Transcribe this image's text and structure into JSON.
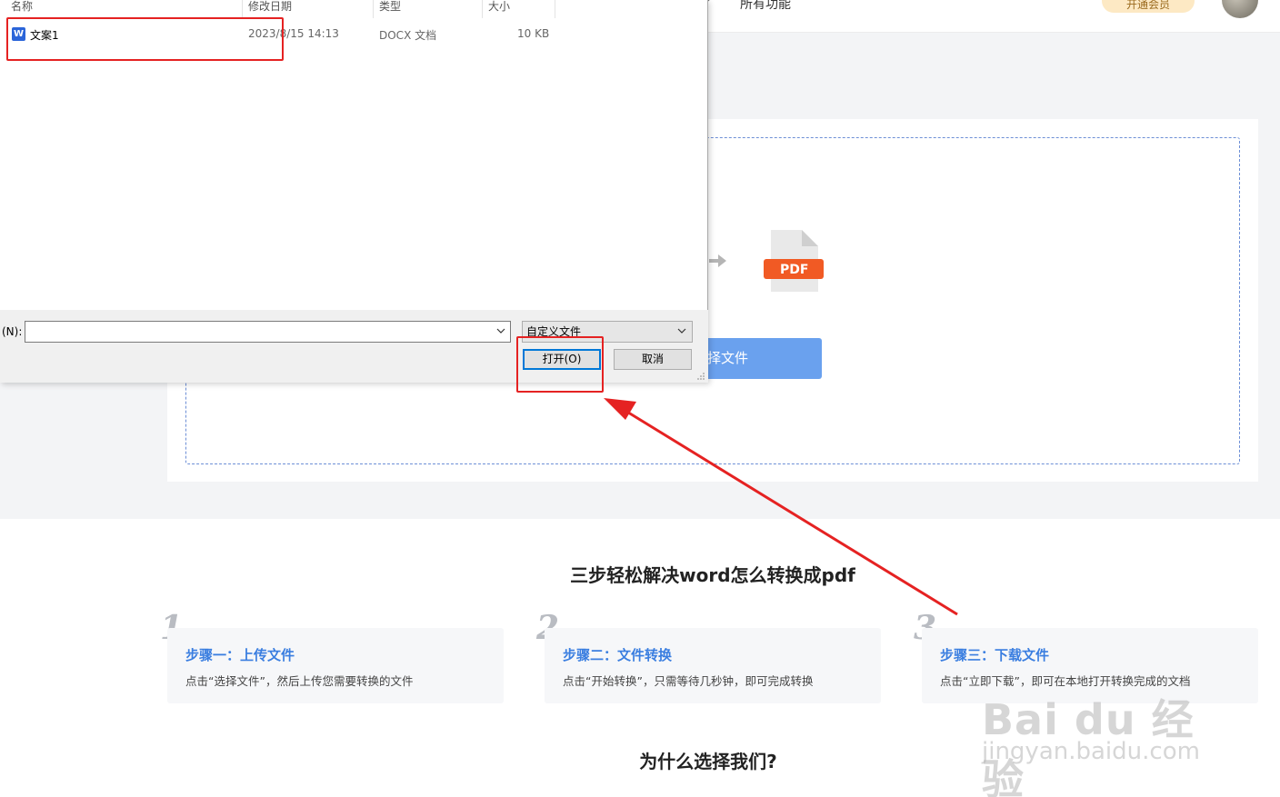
{
  "header": {
    "nav_all": "所有功能",
    "vip": "开通会员"
  },
  "upload": {
    "select_label": "择文件",
    "pdf_label": "PDF"
  },
  "steps": {
    "title": "三步轻松解决word怎么转换成pdf",
    "items": [
      {
        "num": "1",
        "head": "步骤一：上传文件",
        "desc": "点击“选择文件”，然后上传您需要转换的文件"
      },
      {
        "num": "2",
        "head": "步骤二：文件转换",
        "desc": "点击“开始转换”，只需等待几秒钟，即可完成转换"
      },
      {
        "num": "3",
        "head": "步骤三：下载文件",
        "desc": "点击“立即下载”，即可在本地打开转换完成的文档"
      }
    ]
  },
  "why_title": "为什么选择我们?",
  "dialog": {
    "columns": {
      "name": "名称",
      "date": "修改日期",
      "type": "类型",
      "size": "大小"
    },
    "file": {
      "name": "文案1",
      "date": "2023/8/15 14:13",
      "type": "DOCX 文档",
      "size": "10 KB",
      "icon_letter": "W"
    },
    "filename_label": "(N):",
    "filename_value": "",
    "filetype_value": "自定义文件",
    "open_label": "打开(O)",
    "cancel_label": "取消"
  },
  "watermark": {
    "main": "Bai du 经验",
    "sub": "jingyan.baidu.com"
  },
  "colors": {
    "accent": "#3a7ee0",
    "button": "#6aa1ee",
    "annotation": "#e52222",
    "pdf": "#f15a24"
  }
}
